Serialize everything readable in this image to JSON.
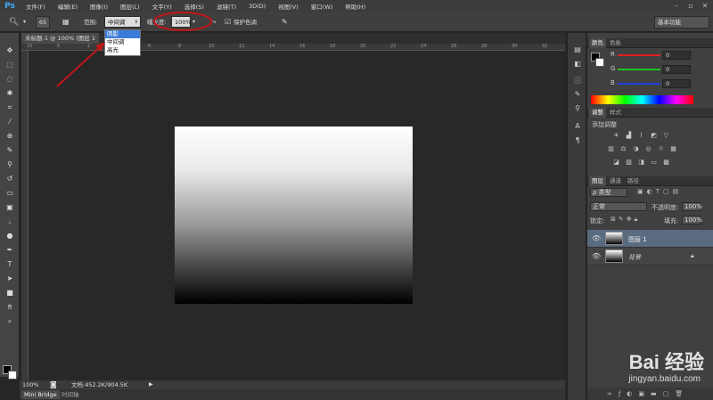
{
  "app": {
    "logo": "Ps"
  },
  "menu": [
    "文件(F)",
    "编辑(E)",
    "图像(I)",
    "图层(L)",
    "文字(Y)",
    "选择(S)",
    "滤镜(T)",
    "3D(D)",
    "视图(V)",
    "窗口(W)",
    "帮助(H)"
  ],
  "window_controls": {
    "minimize": "–",
    "restore": "▫",
    "close": "✕"
  },
  "options": {
    "brush_size": "65",
    "range_label": "范围:",
    "range_value": "中间调",
    "exposure_label": "曝光度:",
    "exposure_value": "100%",
    "protect_tones_label": "保护色调",
    "workspace": "基本功能"
  },
  "range_dropdown": {
    "options": [
      "阴影",
      "中间调",
      "高光"
    ],
    "selected": "阴影"
  },
  "document_tab": {
    "title": "未标题-1 @ 100% (图层 1"
  },
  "ruler_ticks": [
    "10",
    "0",
    "2",
    "4",
    "6",
    "8",
    "10",
    "12",
    "14",
    "16",
    "18",
    "20",
    "22",
    "24",
    "26",
    "28",
    "30",
    "32"
  ],
  "status": {
    "zoom": "100%",
    "doc_info": "文档:452.2K/904.5K"
  },
  "bottom_tabs": [
    "Mini Bridge",
    "时间轴"
  ],
  "color_panel": {
    "tabs": [
      "颜色",
      "色板"
    ],
    "channels": [
      {
        "label": "R",
        "value": "0",
        "color": "#e02020"
      },
      {
        "label": "G",
        "value": "0",
        "color": "#20c020"
      },
      {
        "label": "B",
        "value": "0",
        "color": "#2040e0"
      }
    ]
  },
  "adjustments_panel": {
    "tabs": [
      "调整",
      "样式"
    ],
    "heading": "添加调整"
  },
  "layers_panel": {
    "tabs": [
      "图层",
      "通道",
      "路径"
    ],
    "filter": "ρ 类型",
    "blend_mode": "正常",
    "opacity_label": "不透明度:",
    "opacity_value": "100%",
    "lock_label": "锁定:",
    "fill_label": "填充:",
    "fill_value": "100%",
    "layers": [
      {
        "name": "图层 1",
        "selected": true
      },
      {
        "name": "背景",
        "selected": false
      }
    ]
  },
  "watermark": {
    "brand": "Bai 经验",
    "url": "jingyan.baidu.com"
  },
  "colors": {
    "annotation_red": "#c0161a",
    "highlight_blue": "#3b7bd9"
  }
}
